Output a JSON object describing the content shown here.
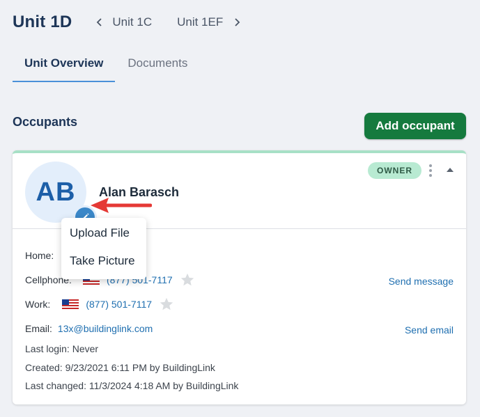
{
  "header": {
    "title": "Unit 1D",
    "prev_unit": "Unit 1C",
    "next_unit": "Unit 1EF"
  },
  "tabs": [
    {
      "label": "Unit Overview",
      "active": true
    },
    {
      "label": "Documents",
      "active": false
    }
  ],
  "occupants": {
    "section_title": "Occupants",
    "add_button_label": "Add occupant"
  },
  "occupant": {
    "initials": "AB",
    "name": "Alan Barasch",
    "role_badge": "OWNER",
    "phones": [
      {
        "label": "Home:",
        "number": "(877) 501-7117",
        "visible_number": "7117"
      },
      {
        "label": "Cellphone:",
        "number": "(877) 501-7117"
      },
      {
        "label": "Work:",
        "number": "(877) 501-7117"
      }
    ],
    "send_message_label": "Send message",
    "email_label": "Email:",
    "email": "13x@buildinglink.com",
    "send_email_label": "Send email",
    "last_login": "Last login:  Never",
    "created": "Created:  9/23/2021 6:11 PM by BuildingLink",
    "last_changed": "Last changed:  11/3/2024 4:18 AM by BuildingLink"
  },
  "avatar_menu": {
    "items": [
      "Upload File",
      "Take Picture"
    ]
  },
  "colors": {
    "accent_green": "#157a3e",
    "owner_badge": "#b8ead2",
    "link_blue": "#1f6fb0",
    "annotation_red": "#e53935"
  }
}
